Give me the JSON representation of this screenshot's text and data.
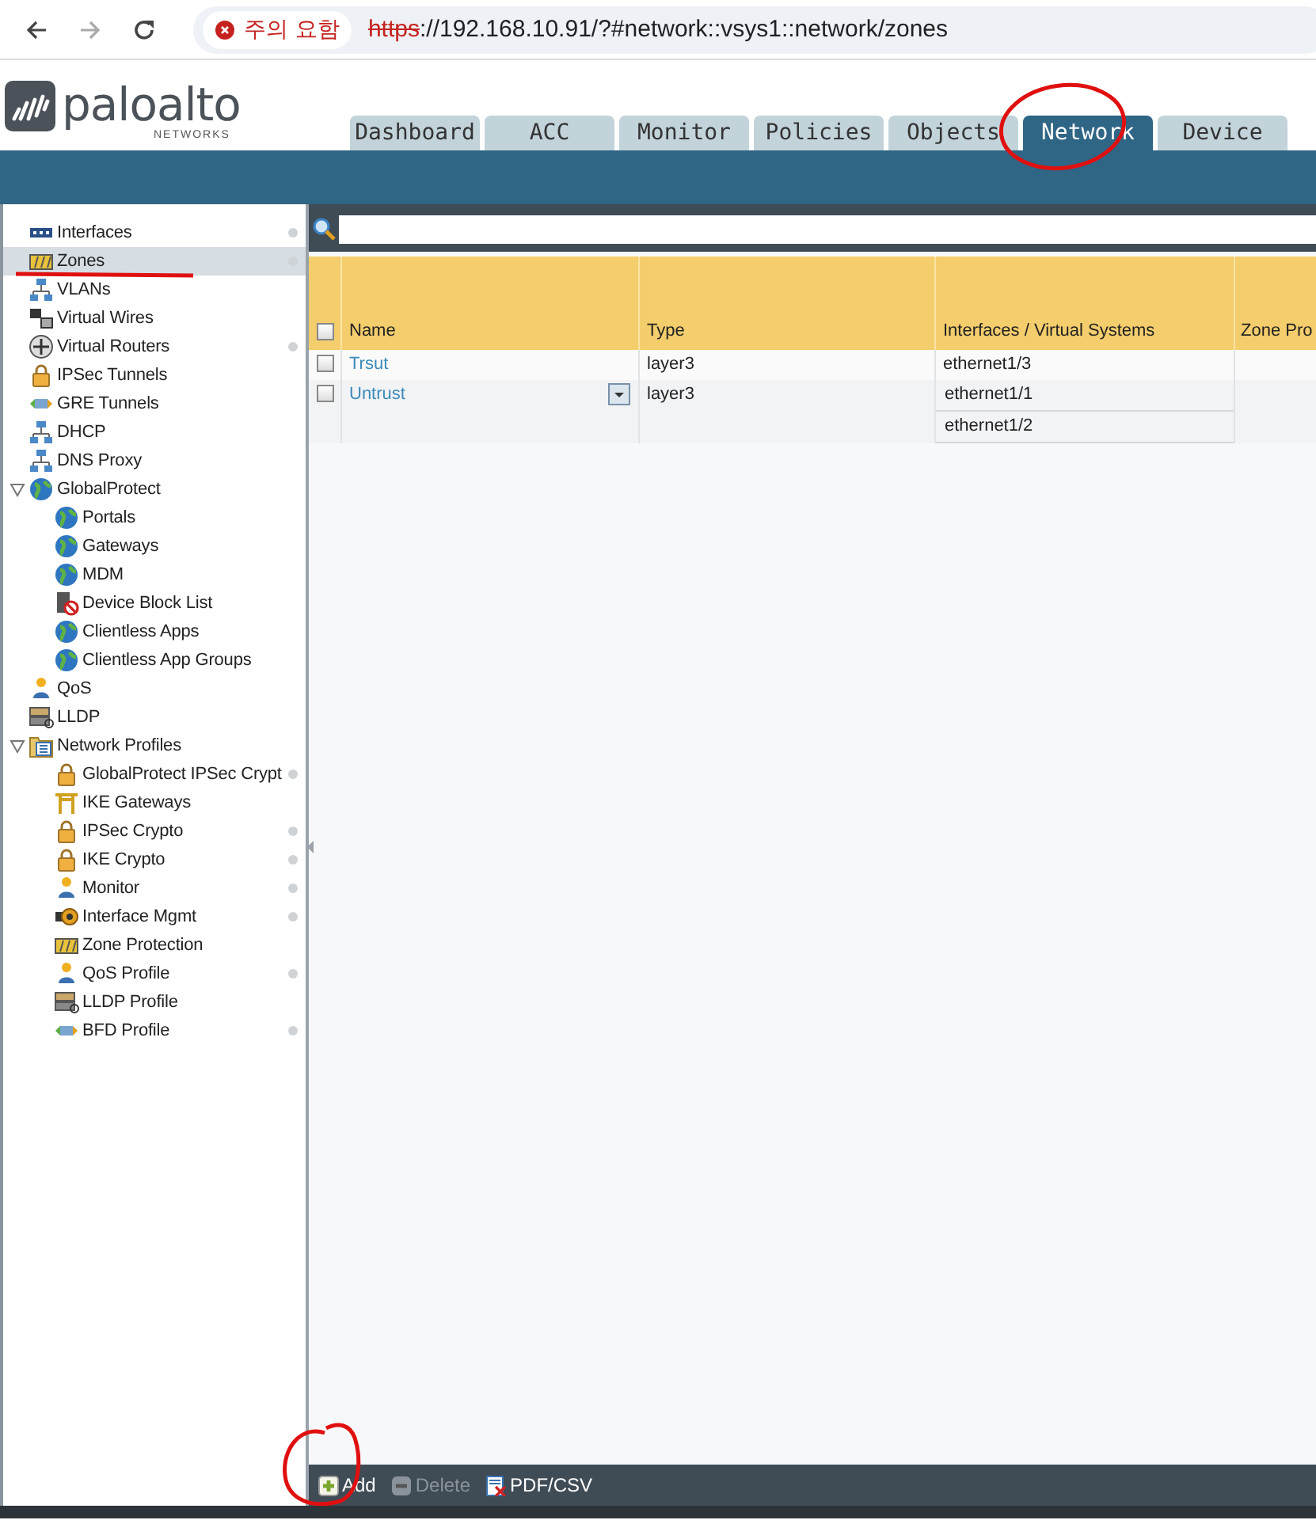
{
  "browser": {
    "security_label": "주의 요함",
    "url_scheme": "https",
    "url_rest": "://192.168.10.91/?#network::vsys1::network/zones"
  },
  "brand": {
    "name": "paloalto",
    "sub": "NETWORKS"
  },
  "tabs": [
    {
      "label": "Dashboard",
      "selected": false
    },
    {
      "label": "ACC",
      "selected": false
    },
    {
      "label": "Monitor",
      "selected": false
    },
    {
      "label": "Policies",
      "selected": false
    },
    {
      "label": "Objects",
      "selected": false
    },
    {
      "label": "Network",
      "selected": true
    },
    {
      "label": "Device",
      "selected": false
    }
  ],
  "sidebar": {
    "items": [
      {
        "label": "Interfaces",
        "selected": false,
        "indicator": true
      },
      {
        "label": "Zones",
        "selected": true,
        "indicator": true
      },
      {
        "label": "VLANs",
        "selected": false,
        "indicator": false
      },
      {
        "label": "Virtual Wires",
        "selected": false,
        "indicator": false
      },
      {
        "label": "Virtual Routers",
        "selected": false,
        "indicator": true
      },
      {
        "label": "IPSec Tunnels",
        "selected": false,
        "indicator": false
      },
      {
        "label": "GRE Tunnels",
        "selected": false,
        "indicator": false
      },
      {
        "label": "DHCP",
        "selected": false,
        "indicator": false
      },
      {
        "label": "DNS Proxy",
        "selected": false,
        "indicator": false
      },
      {
        "label": "GlobalProtect",
        "selected": false,
        "indicator": false,
        "expanded": true,
        "children": [
          {
            "label": "Portals",
            "selected": false,
            "indicator": false
          },
          {
            "label": "Gateways",
            "selected": false,
            "indicator": false
          },
          {
            "label": "MDM",
            "selected": false,
            "indicator": false
          },
          {
            "label": "Device Block List",
            "selected": false,
            "indicator": false
          },
          {
            "label": "Clientless Apps",
            "selected": false,
            "indicator": false
          },
          {
            "label": "Clientless App Groups",
            "selected": false,
            "indicator": false
          }
        ]
      },
      {
        "label": "QoS",
        "selected": false,
        "indicator": false
      },
      {
        "label": "LLDP",
        "selected": false,
        "indicator": false
      },
      {
        "label": "Network Profiles",
        "selected": false,
        "indicator": false,
        "expanded": true,
        "children": [
          {
            "label": "GlobalProtect IPSec Crypt",
            "selected": false,
            "indicator": true
          },
          {
            "label": "IKE Gateways",
            "selected": false,
            "indicator": false
          },
          {
            "label": "IPSec Crypto",
            "selected": false,
            "indicator": true
          },
          {
            "label": "IKE Crypto",
            "selected": false,
            "indicator": true
          },
          {
            "label": "Monitor",
            "selected": false,
            "indicator": true
          },
          {
            "label": "Interface Mgmt",
            "selected": false,
            "indicator": true
          },
          {
            "label": "Zone Protection",
            "selected": false,
            "indicator": false
          },
          {
            "label": "QoS Profile",
            "selected": false,
            "indicator": true
          },
          {
            "label": "LLDP Profile",
            "selected": false,
            "indicator": false
          },
          {
            "label": "BFD Profile",
            "selected": false,
            "indicator": true
          }
        ]
      }
    ]
  },
  "table": {
    "all_checked": false,
    "columns": [
      "Name",
      "Type",
      "Interfaces / Virtual Systems",
      "Zone Pro"
    ],
    "rows": [
      {
        "checked": false,
        "name": "Trsut",
        "type": "layer3",
        "interfaces": [
          "ethernet1/3"
        ],
        "menu_button": false
      },
      {
        "checked": false,
        "name": "Untrust",
        "type": "layer3",
        "interfaces": [
          "ethernet1/1",
          "ethernet1/2"
        ],
        "menu_button": true
      }
    ]
  },
  "actions": [
    {
      "label": "Add",
      "kind": "add",
      "disabled": false
    },
    {
      "label": "Delete",
      "kind": "delete",
      "disabled": true
    },
    {
      "label": "PDF/CSV",
      "kind": "export",
      "disabled": false
    }
  ]
}
